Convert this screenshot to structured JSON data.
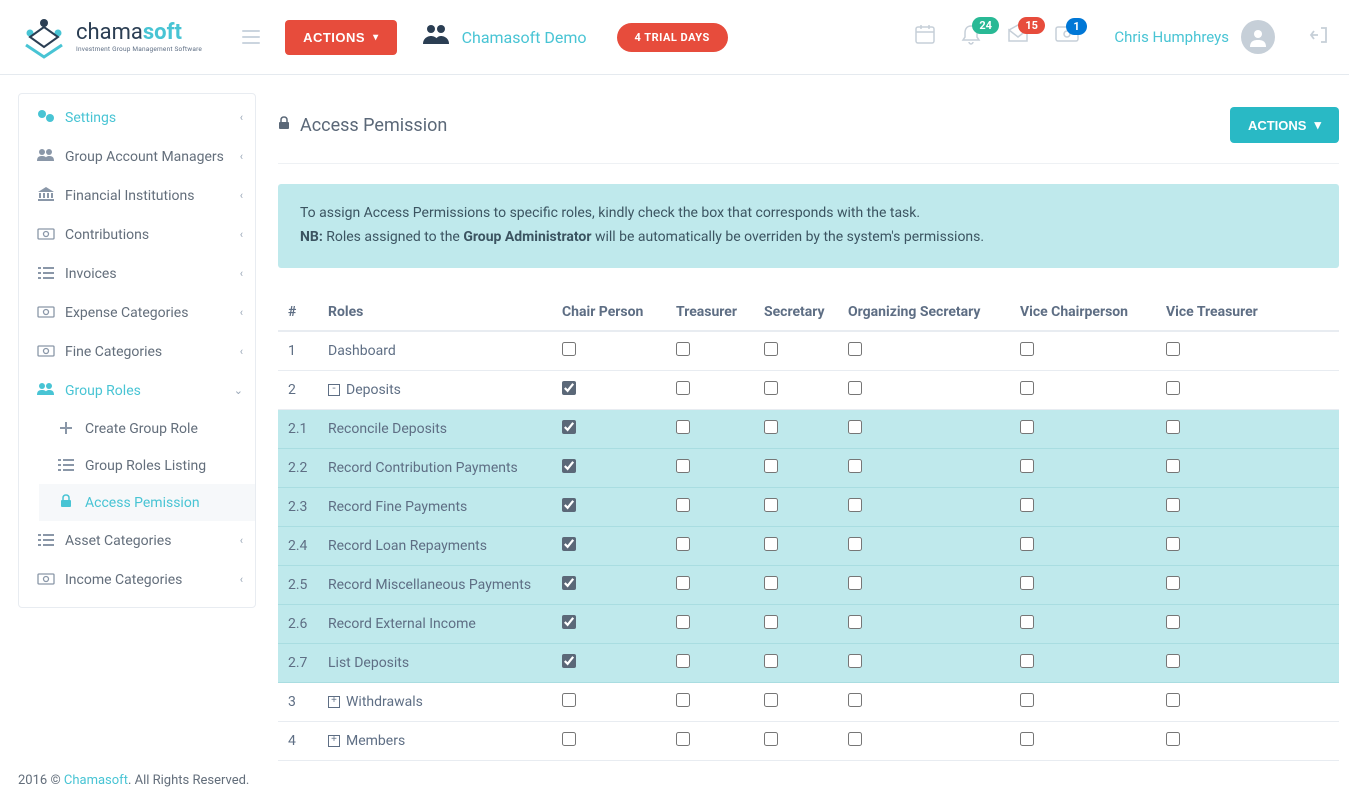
{
  "brand": {
    "name_pre": "chama",
    "name_post": "soft",
    "tagline": "Investment Group Management Software"
  },
  "topbar": {
    "actions_label": "ACTIONS",
    "group_name": "Chamasoft Demo",
    "trial_label": "4 TRIAL DAYS"
  },
  "notifications": {
    "calendar": "",
    "bell": "24",
    "msg": "15",
    "money": "1"
  },
  "user": {
    "name": "Chris Humphreys"
  },
  "sidebar": {
    "top": "Settings",
    "items": [
      {
        "label": "Group Account Managers",
        "icon": "users"
      },
      {
        "label": "Financial Institutions",
        "icon": "bank"
      },
      {
        "label": "Contributions",
        "icon": "money"
      },
      {
        "label": "Invoices",
        "icon": "list"
      },
      {
        "label": "Expense Categories",
        "icon": "money"
      },
      {
        "label": "Fine Categories",
        "icon": "money"
      },
      {
        "label": "Group Roles",
        "icon": "users",
        "open": true
      },
      {
        "label": "Asset Categories",
        "icon": "list"
      },
      {
        "label": "Income Categories",
        "icon": "money"
      }
    ],
    "group_roles_sub": [
      {
        "label": "Create Group Role",
        "icon": "plus"
      },
      {
        "label": "Group Roles Listing",
        "icon": "list"
      },
      {
        "label": "Access Pemission",
        "icon": "lock",
        "selected": true
      }
    ]
  },
  "page": {
    "title": "Access Pemission",
    "actions_label": "ACTIONS",
    "info_line1": "To assign Access Permissions to specific roles, kindly check the box that corresponds with the task.",
    "info_nb_prefix": "NB:",
    "info_nb_a": " Roles assigned to the ",
    "info_nb_b": "Group Administrator",
    "info_nb_c": " will be automatically be overriden by the system's permissions."
  },
  "table": {
    "headers": [
      "#",
      "Roles",
      "Chair Person",
      "Treasurer",
      "Secretary",
      "Organizing Secretary",
      "Vice Chairperson",
      "Vice Treasurer"
    ],
    "rows": [
      {
        "num": "1",
        "label": "Dashboard",
        "expand": null,
        "cp": false
      },
      {
        "num": "2",
        "label": "Deposits",
        "expand": "-",
        "cp": true
      },
      {
        "num": "2.1",
        "label": "Reconcile Deposits",
        "sub": true,
        "cp": true
      },
      {
        "num": "2.2",
        "label": "Record Contribution Payments",
        "sub": true,
        "cp": true
      },
      {
        "num": "2.3",
        "label": "Record Fine Payments",
        "sub": true,
        "cp": true
      },
      {
        "num": "2.4",
        "label": "Record Loan Repayments",
        "sub": true,
        "cp": true
      },
      {
        "num": "2.5",
        "label": "Record Miscellaneous Payments",
        "sub": true,
        "cp": true
      },
      {
        "num": "2.6",
        "label": "Record External Income",
        "sub": true,
        "cp": true
      },
      {
        "num": "2.7",
        "label": "List Deposits",
        "sub": true,
        "cp": true
      },
      {
        "num": "3",
        "label": "Withdrawals",
        "expand": "+",
        "cp": false
      },
      {
        "num": "4",
        "label": "Members",
        "expand": "+",
        "cp": false
      }
    ]
  },
  "footer": {
    "year": "2016 © ",
    "brand": "Chamasoft",
    "rest": ". All Rights Reserved."
  }
}
